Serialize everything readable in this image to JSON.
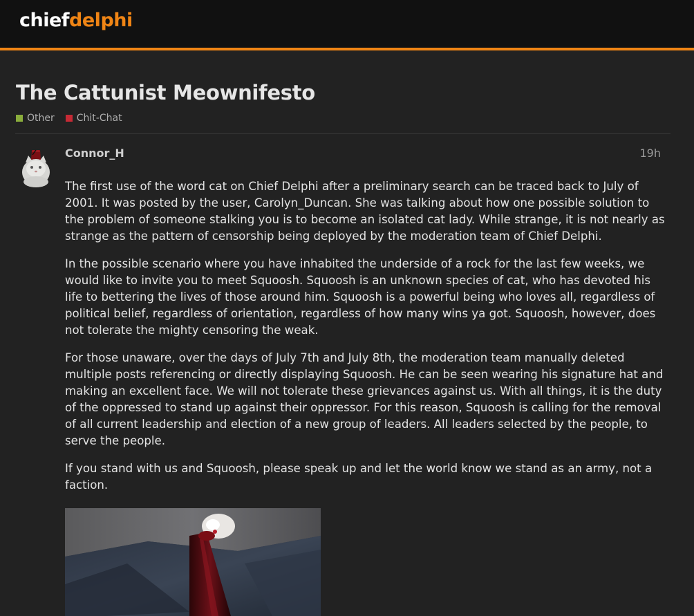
{
  "header": {
    "logo_part1": "chief",
    "logo_part2": "delphi"
  },
  "topic": {
    "title": "The Cattunist Meownifesto",
    "categories": [
      {
        "label": "Other",
        "color": "#8aad3c"
      },
      {
        "label": "Chit-Chat",
        "color": "#c62a35"
      }
    ]
  },
  "post": {
    "username": "Connor_H",
    "date": "19h",
    "paragraphs": [
      "The first use of the word cat on Chief Delphi after a preliminary search can be traced back to July of 2001. It was posted by the user, Carolyn_Duncan. She was talking about how one possible solution to the problem of someone stalking you is to become an isolated cat lady. While strange, it is not nearly as strange as the pattern of censorship being deployed by the moderation team of Chief Delphi.",
      "In the possible scenario where you have inhabited the underside of a rock for the last few weeks, we would like to invite you to meet Squoosh. Squoosh is an unknown species of cat, who has devoted his life to bettering the lives of those around him. Squoosh is a powerful being who loves all, regardless of political belief, regardless of orientation, regardless of how many wins ya got. Squoosh, however, does not tolerate the mighty censoring the weak.",
      "For those unaware, over the days of July 7th and July 8th, the moderation team manually deleted multiple posts referencing or directly displaying Squoosh. He can be seen wearing his signature hat and making an excellent face. We will not tolerate these grievances against us. With all things, it is the duty of the oppressed to stand up against their oppressor. For this reason, Squoosh is calling for the removal of all current leadership and election of a new group of leaders. All leaders selected by the people, to serve the people.",
      "If you stand with us and Squoosh, please speak up and let the world know we stand as an army, not a faction."
    ]
  },
  "colors": {
    "accent": "#f08515",
    "background": "#222222",
    "header": "#111111"
  }
}
